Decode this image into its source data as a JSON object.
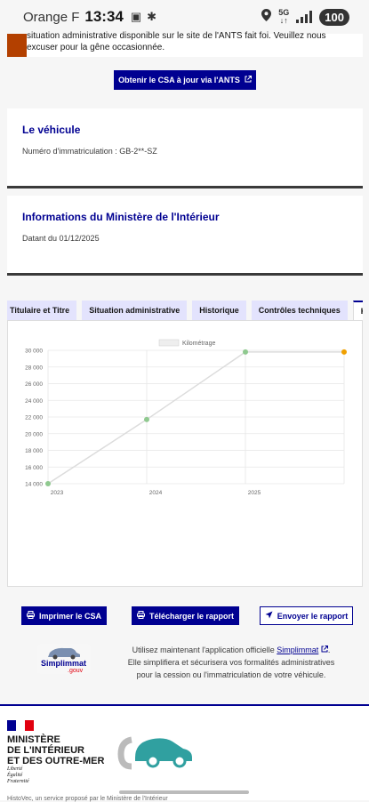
{
  "status_bar": {
    "carrier": "Orange F",
    "time": "13:34",
    "network": "5G",
    "battery": "100"
  },
  "notice": {
    "text": "situation administrative disponible sur le site de l'ANTS fait foi. Veuillez nous excuser pour la gêne occasionnée."
  },
  "csa_button": {
    "label": "Obtenir le CSA à jour via l'ANTS"
  },
  "vehicle": {
    "title": "Le véhicule",
    "plate_label": "Numéro d'immatriculation : GB-2**-SZ"
  },
  "ministry_info": {
    "title": "Informations du Ministère de l'Intérieur",
    "date": "Datant du 01/12/2025"
  },
  "tabs": [
    "Titulaire et Titre",
    "Situation administrative",
    "Historique",
    "Contrôles techniques",
    "Kilo"
  ],
  "chart_data": {
    "type": "line",
    "legend": "Kilométrage",
    "x": [
      "2023",
      "2024",
      "2025",
      ""
    ],
    "series": [
      {
        "name": "Kilométrage",
        "values": [
          14000,
          21700,
          29800,
          29800
        ]
      }
    ],
    "point_colors": [
      "#8fc98f",
      "#8fc98f",
      "#8fc98f",
      "#f0a000"
    ],
    "y_ticks": [
      "30 000",
      "28 000",
      "26 000",
      "24 000",
      "22 000",
      "20 000",
      "18 000",
      "16 000",
      "14 000"
    ],
    "ylim": [
      14000,
      30000
    ],
    "grid": true,
    "legend_position": "top"
  },
  "actions": {
    "print": "Imprimer le CSA",
    "download": "Télécharger le rapport",
    "send": "Envoyer le rapport"
  },
  "promo": {
    "logo_text": "Simplimmat",
    "logo_sub": ".gouv",
    "line1_prefix": "Utilisez maintenant l'application officielle ",
    "link": "Simplimmat",
    "line2": "Elle simplifiera et sécurisera vos formalités administratives",
    "line3": "pour la cession ou l'immatriculation de votre véhicule."
  },
  "footer": {
    "ministry": [
      "MINISTÈRE",
      "DE L'INTÉRIEUR",
      "ET DES OUTRE-MER"
    ],
    "devise": [
      "Liberté",
      "Égalité",
      "Fraternité"
    ],
    "small": "HistoVec, un service proposé par le Ministère de l'Intérieur"
  }
}
